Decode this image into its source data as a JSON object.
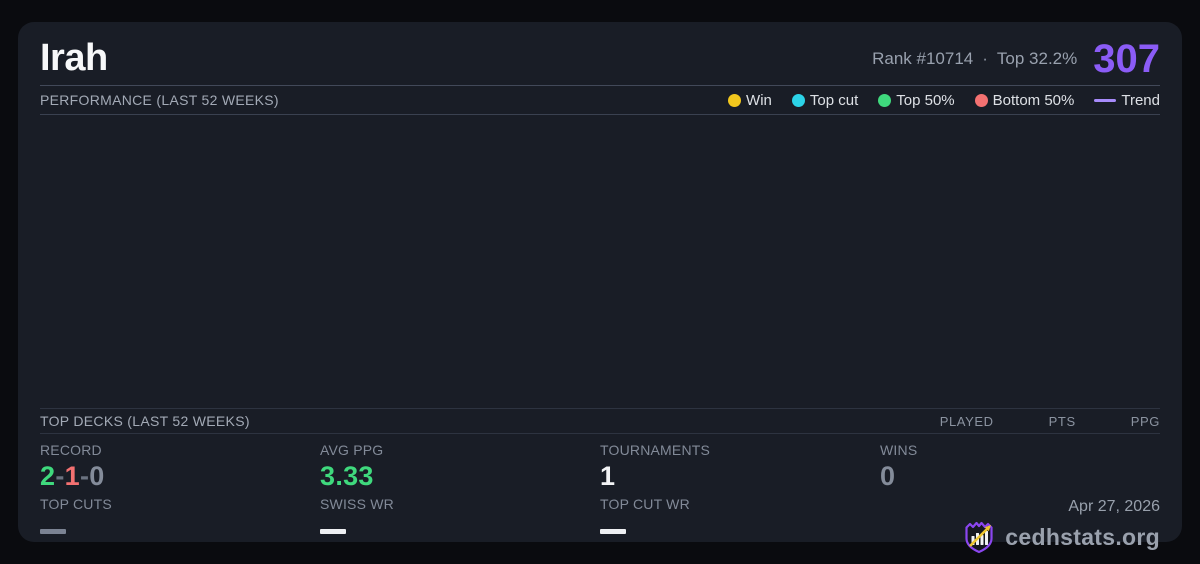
{
  "header": {
    "title": "Irah",
    "rank_text": "Rank #10714",
    "dot_separator": "·",
    "top_percent_text": "Top 32.2%",
    "score": "307"
  },
  "performance": {
    "section_title": "PERFORMANCE (LAST 52 WEEKS)",
    "legend": [
      {
        "label": "Win",
        "color": "#f2c71d"
      },
      {
        "label": "Top cut",
        "color": "#2cd3e8"
      },
      {
        "label": "Top 50%",
        "color": "#3fd97d"
      },
      {
        "label": "Bottom 50%",
        "color": "#f47171"
      },
      {
        "label": "Trend",
        "color": "#a78bfa"
      }
    ]
  },
  "top_decks": {
    "section_title": "TOP DECKS (LAST 52 WEEKS)",
    "columns": [
      "PLAYED",
      "PTS",
      "PPG"
    ]
  },
  "stats": {
    "record": {
      "label": "RECORD",
      "wins": "2",
      "sep1": "-",
      "losses": "1",
      "sep2": "-",
      "draws": "0"
    },
    "avg_ppg": {
      "label": "AVG PPG",
      "value": "3.33"
    },
    "tournaments": {
      "label": "TOURNAMENTS",
      "value": "1"
    },
    "wins": {
      "label": "WINS",
      "value": "0"
    },
    "top_cuts": {
      "label": "TOP CUTS"
    },
    "swiss_wr": {
      "label": "SWISS WR"
    },
    "top_cut_wr": {
      "label": "TOP CUT WR"
    }
  },
  "footer": {
    "date": "Apr 27, 2026",
    "brand": "cedhstats.org"
  },
  "colors": {
    "accent_purple": "#8b5cf6",
    "win_green": "#3fd97d",
    "loss_red": "#f47171",
    "gold_win": "#f2c71d",
    "topcut_cyan": "#2cd3e8",
    "trend_purple": "#a78bfa",
    "card_bg": "#191d26",
    "page_bg": "#0a0b0f"
  }
}
